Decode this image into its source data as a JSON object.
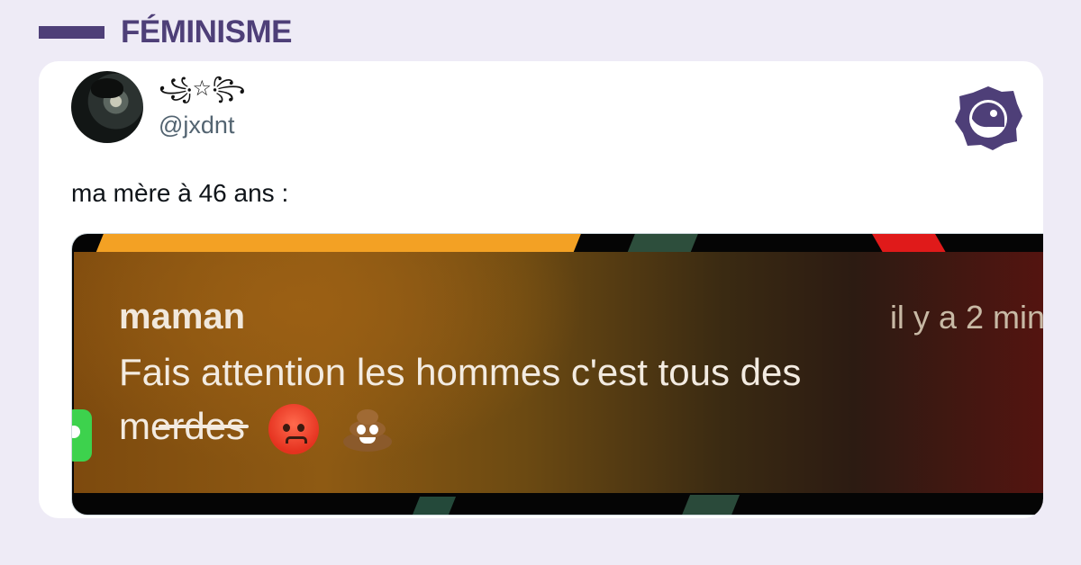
{
  "category": {
    "label": "FÉMINISME",
    "color": "#4e3f78"
  },
  "tweet": {
    "display_name": "꧁☆꧂",
    "handle": "@jxdnt",
    "text": "ma mère à 46 ans :",
    "avatar_icon": "avatar-photo",
    "brand_icon": "brand-logo-icon"
  },
  "screenshot": {
    "sender": "maman",
    "time": "il y a 2 min",
    "line1": "Fais attention les hommes c'est tous des",
    "line2": "merdes",
    "emojis": [
      "angry-face-icon",
      "pile-of-poo-icon"
    ]
  }
}
